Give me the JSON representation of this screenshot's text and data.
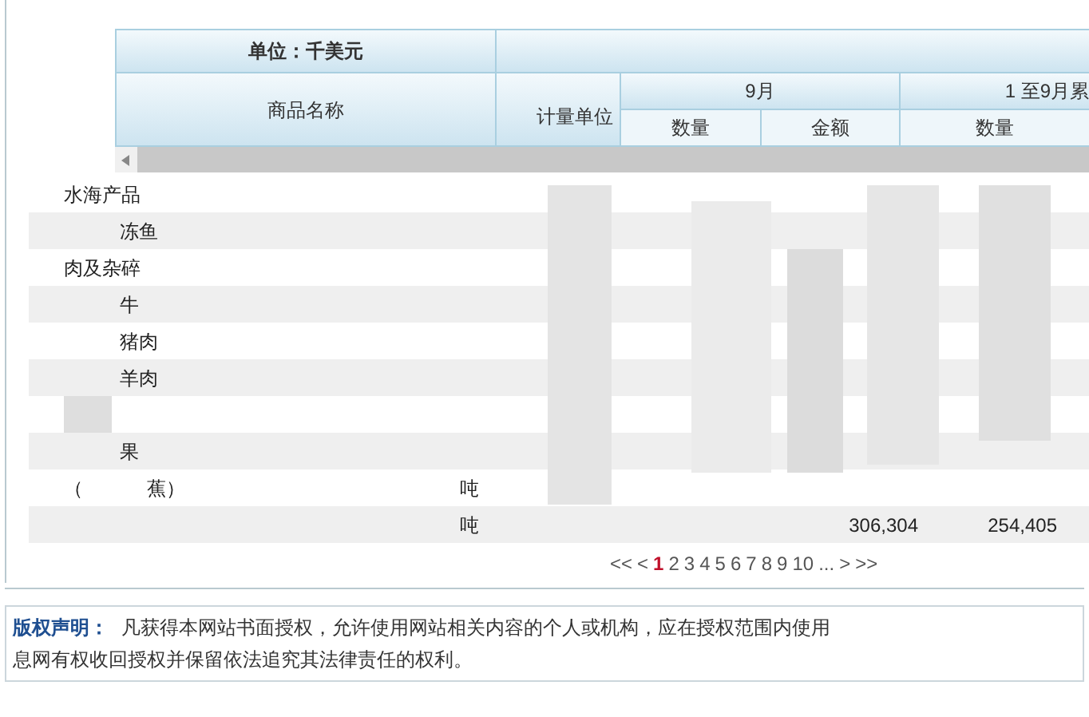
{
  "table": {
    "unit_caption": "单位：千美元",
    "columns": {
      "name": "商品名称",
      "unit": "计量单位",
      "period_1": "9月",
      "period_2": "1 至9月累",
      "period_1_sub": [
        "数量",
        "金额"
      ],
      "period_2_sub": [
        "数量"
      ]
    },
    "rows": [
      {
        "name": "水海产品",
        "children": [
          {
            "name": "冻鱼"
          }
        ]
      },
      {
        "name": "肉及杂碎",
        "children": [
          {
            "name": "牛"
          },
          {
            "name": "猪肉"
          },
          {
            "name": "羊肉"
          },
          {
            "kind": "blurred"
          },
          {
            "name": "果"
          }
        ]
      },
      {
        "name": "（",
        "name_tail": "蕉）",
        "unit": "吨"
      },
      {
        "unit": "吨",
        "values": [
          "306,304",
          "254,405"
        ]
      }
    ]
  },
  "pagination": {
    "first": "<<",
    "prev": "<",
    "pages": [
      {
        "label": "1",
        "selected": true
      },
      {
        "label": "2",
        "selected": false
      },
      {
        "label": "3",
        "selected": false
      },
      {
        "label": "4",
        "selected": false
      },
      {
        "label": "5",
        "selected": false
      },
      {
        "label": "6",
        "selected": false
      },
      {
        "label": "7",
        "selected": false
      },
      {
        "label": "8",
        "selected": false
      },
      {
        "label": "9",
        "selected": false
      },
      {
        "label": "10",
        "selected": false
      }
    ],
    "ellipsis": "...",
    "next": ">",
    "last": ">>"
  },
  "notice": {
    "label": "版权声明：",
    "text": "凡获得本网站书面授权，允许使用网站相关内容的个人或机构，应在授权范围内使用",
    "text_2": "息网有权收回授权并保留依法追究其法律责任的权利。"
  }
}
